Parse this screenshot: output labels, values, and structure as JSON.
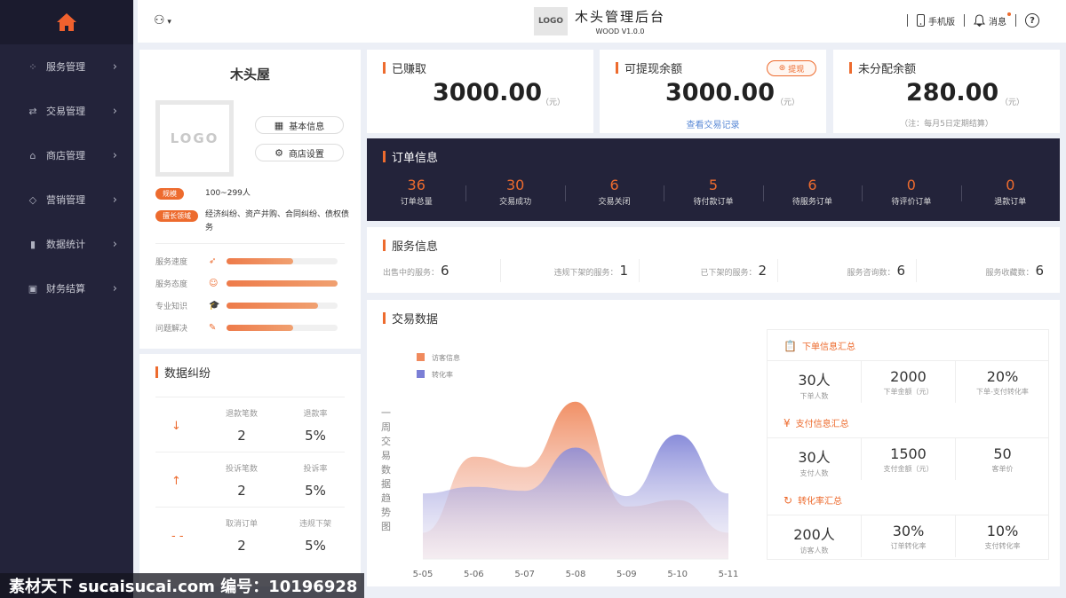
{
  "sidebar": {
    "home_icon": "home-icon",
    "items": [
      {
        "label": "服务管理",
        "icon": "grid-icon"
      },
      {
        "label": "交易管理",
        "icon": "swap-icon"
      },
      {
        "label": "商店管理",
        "icon": "store-icon"
      },
      {
        "label": "营销管理",
        "icon": "tag-icon"
      },
      {
        "label": "数据统计",
        "icon": "bar-chart-icon"
      },
      {
        "label": "财务结算",
        "icon": "wallet-icon"
      }
    ]
  },
  "header": {
    "logo_text": "LOGO",
    "title": "木头管理后台",
    "version": "WOOD V1.0.0",
    "mobile_label": "手机版",
    "message_label": "消息",
    "accent": "#ed6b2e"
  },
  "profile": {
    "shop_name": "木头屋",
    "logo_text": "LOGO",
    "basic_info_label": "基本信息",
    "shop_settings_label": "商店设置",
    "scale_tag": "规模",
    "scale_value": "100~299人",
    "field_tag": "擅长领域",
    "field_value": "经济纠纷、资产并购、合同纠纷、债权债务",
    "metrics": [
      {
        "label": "服务速度",
        "icon": "rocket-icon",
        "level": 0.6
      },
      {
        "label": "服务态度",
        "icon": "smile-icon",
        "level": 1.0
      },
      {
        "label": "专业知识",
        "icon": "graduation-icon",
        "level": 0.82
      },
      {
        "label": "问题解决",
        "icon": "edit-icon",
        "level": 0.6
      }
    ]
  },
  "dispute": {
    "title": "数据纠纷",
    "rows": [
      {
        "icon": "arrow-down-icon",
        "glyph": "↓",
        "a_label": "退款笔数",
        "a_value": "2",
        "b_label": "退款率",
        "b_value": "5%"
      },
      {
        "icon": "arrow-up-icon",
        "glyph": "↑",
        "a_label": "投诉笔数",
        "a_value": "2",
        "b_label": "投诉率",
        "b_value": "5%"
      },
      {
        "icon": "dash-icon",
        "glyph": "- -",
        "a_label": "取消订单",
        "a_value": "2",
        "b_label": "违规下架",
        "b_value": "5%"
      }
    ]
  },
  "stats": {
    "earned": {
      "title": "已赚取",
      "value": "3000.00",
      "unit": "（元）"
    },
    "withdrawable": {
      "title": "可提现余额",
      "value": "3000.00",
      "unit": "（元）",
      "button": "提现",
      "link": "查看交易记录"
    },
    "undistributed": {
      "title": "未分配余额",
      "value": "280.00",
      "unit": "（元）",
      "note": "（注：每月5日定期结算）"
    }
  },
  "order": {
    "title": "订单信息",
    "cells": [
      {
        "value": "36",
        "label": "订单总量"
      },
      {
        "value": "30",
        "label": "交易成功"
      },
      {
        "value": "6",
        "label": "交易关闭"
      },
      {
        "value": "5",
        "label": "待付款订单"
      },
      {
        "value": "6",
        "label": "待服务订单"
      },
      {
        "value": "0",
        "label": "待评价订单"
      },
      {
        "value": "0",
        "label": "退款订单"
      }
    ]
  },
  "service": {
    "title": "服务信息",
    "cells": [
      {
        "label": "出售中的服务：",
        "value": "6"
      },
      {
        "label": "违规下架的服务：",
        "value": "1"
      },
      {
        "label": "已下架的服务：",
        "value": "2"
      },
      {
        "label": "服务咨询数：",
        "value": "6"
      },
      {
        "label": "服务收藏数：",
        "value": "6"
      }
    ]
  },
  "trade": {
    "title": "交易数据",
    "vertical_label": "一周交易数据趋势图",
    "summaries": [
      {
        "title": "下单信息汇总",
        "icon": "document-icon",
        "glyph": "📋",
        "items": [
          {
            "value": "30人",
            "label": "下单人数"
          },
          {
            "value": "2000",
            "label": "下单金额（元）"
          },
          {
            "value": "20%",
            "label": "下单-支付转化率"
          }
        ]
      },
      {
        "title": "支付信息汇总",
        "icon": "yen-icon",
        "glyph": "¥",
        "items": [
          {
            "value": "30人",
            "label": "支付人数"
          },
          {
            "value": "1500",
            "label": "支付金额（元）"
          },
          {
            "value": "50",
            "label": "客单价"
          }
        ]
      },
      {
        "title": "转化率汇总",
        "icon": "refresh-icon",
        "glyph": "↻",
        "items": [
          {
            "value": "200人",
            "label": "访客人数"
          },
          {
            "value": "30%",
            "label": "订单转化率"
          },
          {
            "value": "10%",
            "label": "支付转化率"
          }
        ]
      }
    ]
  },
  "chart_data": {
    "type": "area",
    "title": "一周交易数据趋势图",
    "categories": [
      "5-05",
      "5-06",
      "5-07",
      "5-08",
      "5-09",
      "5-10",
      "5-11"
    ],
    "series": [
      {
        "name": "访客信息",
        "color": "#f08a5d",
        "values": [
          20,
          78,
          70,
          120,
          40,
          45,
          20
        ]
      },
      {
        "name": "转化率",
        "color": "#7b7fd6",
        "values": [
          50,
          55,
          52,
          85,
          48,
          95,
          50
        ]
      }
    ],
    "ylim": [
      0,
      130
    ],
    "legend": "top-left",
    "grid": false
  },
  "watermark": "素材天下 sucaisucai.com  编号：10196928"
}
